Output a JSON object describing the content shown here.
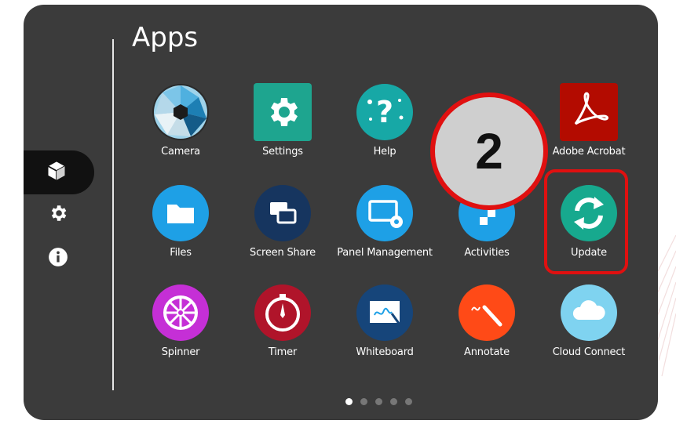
{
  "page": {
    "title": "Apps"
  },
  "sidebar": {
    "items": [
      {
        "icon": "cube-icon",
        "active": true
      },
      {
        "icon": "gear-icon",
        "active": false
      },
      {
        "icon": "info-icon",
        "active": false
      }
    ]
  },
  "apps": [
    {
      "label": "Camera",
      "icon": "camera-shutter-icon"
    },
    {
      "label": "Settings",
      "icon": "gear-icon"
    },
    {
      "label": "Help",
      "icon": "help-icon"
    },
    {
      "label": "Adobe Acrobat",
      "icon": "acrobat-icon"
    },
    {
      "label": "Files",
      "icon": "folder-icon"
    },
    {
      "label": "Screen Share",
      "icon": "screen-share-icon"
    },
    {
      "label": "Panel Management",
      "icon": "panel-management-icon"
    },
    {
      "label": "Activities",
      "icon": "activities-icon"
    },
    {
      "label": "Update",
      "icon": "update-icon"
    },
    {
      "label": "Spinner",
      "icon": "spinner-wheel-icon"
    },
    {
      "label": "Timer",
      "icon": "timer-icon"
    },
    {
      "label": "Whiteboard",
      "icon": "whiteboard-icon"
    },
    {
      "label": "Annotate",
      "icon": "annotate-icon"
    },
    {
      "label": "Cloud Connect",
      "icon": "cloud-icon"
    }
  ],
  "callout": {
    "number": "2"
  },
  "pagination": {
    "pages": 5,
    "current": 1
  },
  "colors": {
    "panel": "#3b3b3b",
    "highlight": "#e01010",
    "badge": "#cfcfcf"
  }
}
